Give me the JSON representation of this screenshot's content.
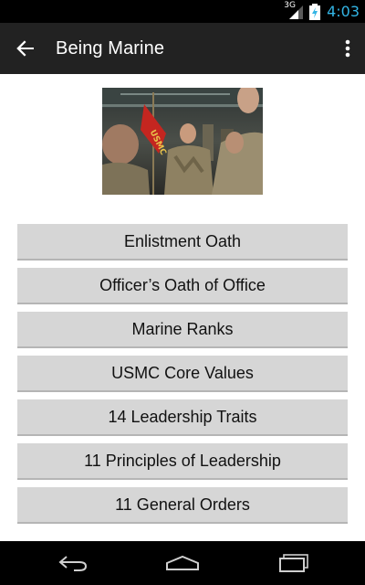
{
  "status_bar": {
    "network_type": "3G",
    "time": "4:03",
    "icons": [
      "signal-icon",
      "battery-charging-icon"
    ],
    "accent_color": "#33b5e5"
  },
  "action_bar": {
    "title": "Being Marine",
    "back_icon": "back-arrow-icon",
    "overflow_icon": "overflow-menu-icon",
    "background": "#222222"
  },
  "hero": {
    "flag_text": "USMC"
  },
  "menu": {
    "items": [
      "Enlistment Oath",
      "Officer’s Oath of Office",
      "Marine Ranks",
      "USMC Core Values",
      "14 Leadership Traits",
      "11 Principles of Leadership",
      "11 General Orders"
    ]
  },
  "nav_bar": {
    "icons": [
      "back-nav-icon",
      "home-nav-icon",
      "recents-nav-icon"
    ]
  }
}
